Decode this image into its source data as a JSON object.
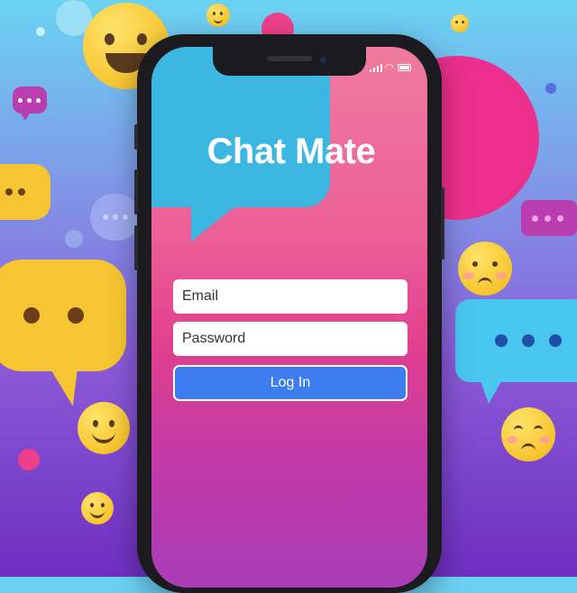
{
  "app": {
    "title": "Chat Mate"
  },
  "status_bar": {
    "icons": [
      "signal-icon",
      "wifi-icon",
      "battery-icon"
    ]
  },
  "login_form": {
    "email": {
      "placeholder": "Email",
      "value": ""
    },
    "password": {
      "placeholder": "Password",
      "value": ""
    },
    "login_button_label": "Log In"
  },
  "colors": {
    "button_blue": "#3d7df0",
    "header_cyan": "#3cb7e2",
    "pink_circle": "#ec2f8c",
    "emoji_yellow": "#f7c52e",
    "bubble_cyan": "#49c6ee",
    "bubble_magenta": "#b93fb0"
  }
}
